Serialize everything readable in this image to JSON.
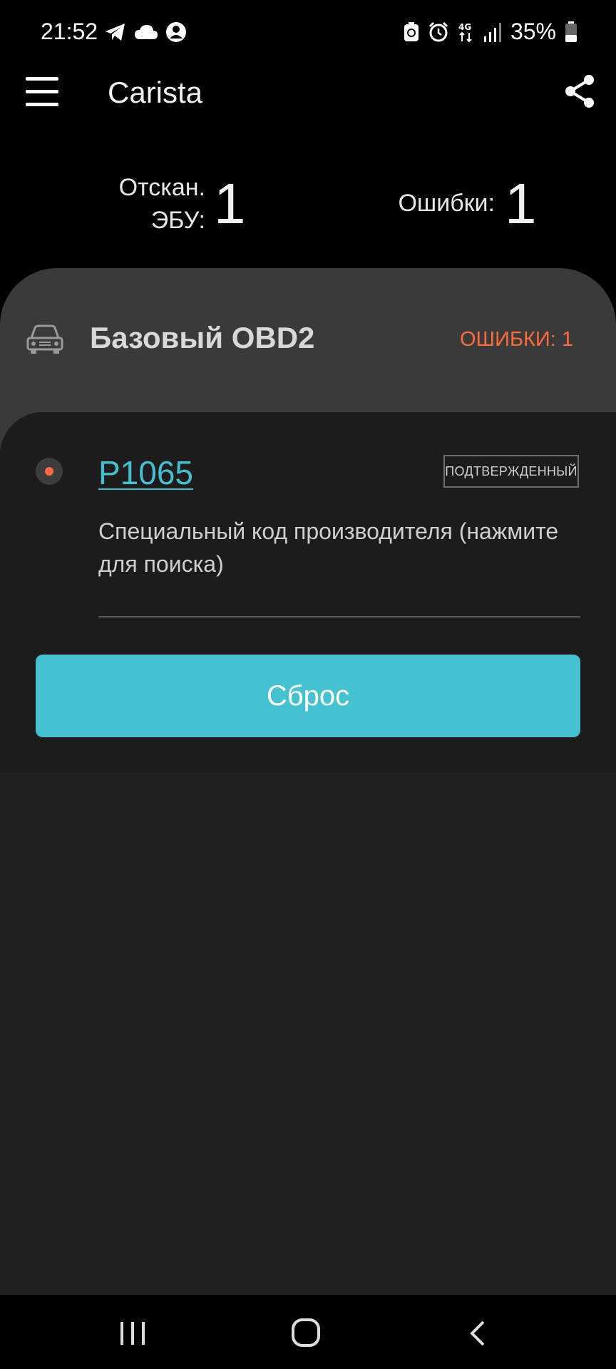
{
  "status_bar": {
    "time": "21:52",
    "left_icons": [
      "telegram-icon",
      "cloud-icon",
      "account-icon"
    ],
    "right_icons": [
      "battery-saver-icon",
      "alarm-icon",
      "network-4g-icon",
      "signal-icon",
      "battery-icon"
    ],
    "battery_percent": "35%"
  },
  "app_bar": {
    "title": "Carista",
    "menu_icon": "hamburger-menu-icon",
    "share_icon": "share-icon"
  },
  "stats": {
    "scanned_label": "Отскан.\nЭБУ:",
    "scanned_value": "1",
    "errors_label": "Ошибки:",
    "errors_value": "1"
  },
  "ecu": {
    "icon": "car-icon",
    "title": "Базовый OBD2",
    "errors_text": "ОШИБКИ: 1",
    "errors_color": "#ff6b3d"
  },
  "dtc": {
    "code": "P1065",
    "status_badge": "ПОДТВЕРЖДЕННЫЙ",
    "description": "Специальный код производителя (нажмите для поиска)",
    "code_color": "#45bfcf"
  },
  "reset_button": {
    "label": "Сброс",
    "color": "#45c1cf"
  },
  "nav_bar": {
    "icons": [
      "recent-apps-icon",
      "home-icon",
      "back-icon"
    ]
  }
}
